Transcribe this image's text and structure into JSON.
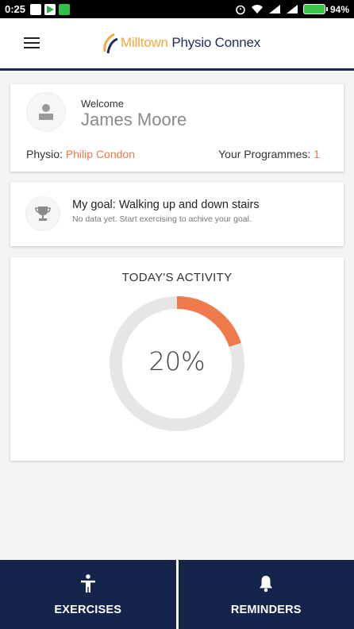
{
  "status_bar": {
    "time": "0:25",
    "battery": "94%",
    "icons": [
      "notification-icon",
      "play-store-icon",
      "app-icon",
      "alarm-icon",
      "wifi-icon",
      "signal-icon",
      "battery-icon"
    ]
  },
  "app_bar": {
    "brand_part": "Milltown",
    "title_rest": " Physio Connex",
    "menu_icon": "hamburger-menu-icon"
  },
  "profile": {
    "welcome": "Welcome",
    "name": "James Moore",
    "physio_label": "Physio:",
    "physio_name": "Philip Condon",
    "programmes_label": "Your Programmes:",
    "programmes_count": "1"
  },
  "goal": {
    "title": "My goal: Walking up and down stairs",
    "subtitle": "No data yet. Start exercising to achive your goal."
  },
  "activity": {
    "title": "TODAY'S ACTIVITY",
    "percent_label": "20%",
    "progress": 0.2,
    "accent": "#ef7a4c",
    "track": "#e6e6e6"
  },
  "bottom_nav": {
    "exercises": "EXERCISES",
    "reminders": "REMINDERS",
    "bg": "#15244a"
  }
}
